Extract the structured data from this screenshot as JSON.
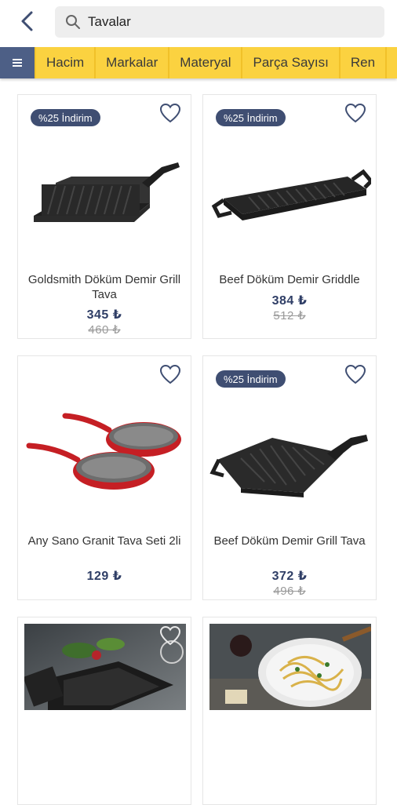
{
  "search": {
    "query": "Tavalar"
  },
  "filters": [
    "Hacim",
    "Markalar",
    "Materyal",
    "Parça Sayısı",
    "Ren"
  ],
  "products": [
    {
      "name": "Goldsmith Döküm Demir Grill Tava",
      "price": "345 ₺",
      "old_price": "460 ₺",
      "badge": "%25 İndirim",
      "image": "square-grill-pan"
    },
    {
      "name": "Beef Döküm Demir Griddle",
      "price": "384 ₺",
      "old_price": "512 ₺",
      "badge": "%25 İndirim",
      "image": "griddle-plate"
    },
    {
      "name": "Any Sano Granit Tava Seti 2li",
      "price": "129 ₺",
      "old_price": "",
      "badge": "",
      "image": "red-pan-set"
    },
    {
      "name": "Beef Döküm Demir Grill Tava",
      "price": "372 ₺",
      "old_price": "496 ₺",
      "badge": "%25 İndirim",
      "image": "grill-pan"
    },
    {
      "name": "",
      "price": "",
      "old_price": "",
      "badge": "",
      "image": "roasting-pan-photo"
    },
    {
      "name": "",
      "price": "",
      "old_price": "",
      "badge": "",
      "image": "pasta-dish-photo"
    }
  ],
  "colors": {
    "accent": "#fbd240",
    "navy": "#3f4e72",
    "price": "#2f3e66"
  }
}
